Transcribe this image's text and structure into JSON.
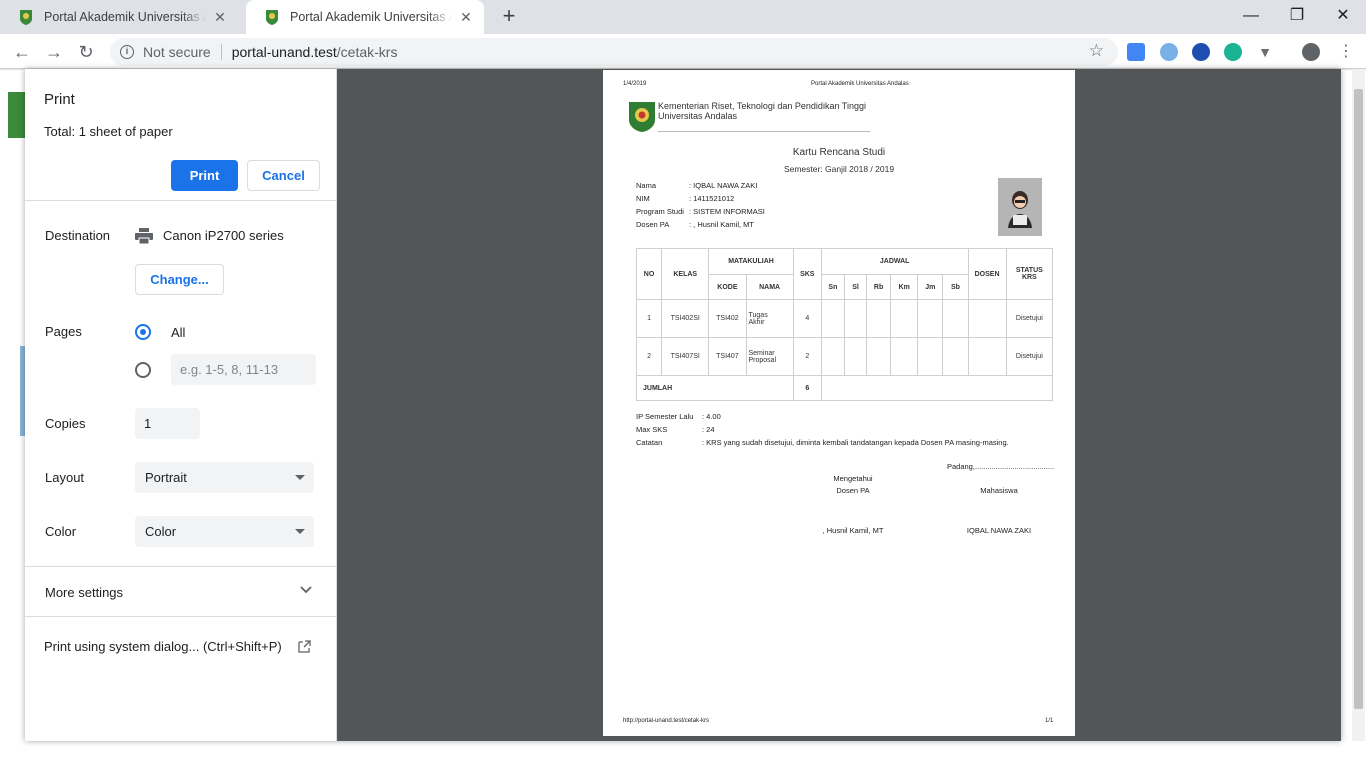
{
  "browser": {
    "tabs": [
      {
        "title": "Portal Akademik Universitas Andalas",
        "active": false
      },
      {
        "title": "Portal Akademik Universitas Andalas",
        "active": true
      }
    ],
    "new_tab": "+",
    "url_security": "Not secure",
    "url_host": "portal-unand.test",
    "url_path": "/cetak-krs"
  },
  "print_dialog": {
    "title": "Print",
    "total_label": "Total:",
    "total_value": "1 sheet of paper",
    "print_button": "Print",
    "cancel_button": "Cancel",
    "destination_label": "Destination",
    "destination_value": "Canon iP2700 series",
    "change_button": "Change...",
    "pages_label": "Pages",
    "pages_all": "All",
    "pages_custom_placeholder": "e.g. 1-5, 8, 11-13",
    "copies_label": "Copies",
    "copies_value": "1",
    "layout_label": "Layout",
    "layout_value": "Portrait",
    "color_label": "Color",
    "color_value": "Color",
    "more_settings": "More settings",
    "system_dialog": "Print using system dialog... (Ctrl+Shift+P)"
  },
  "paper": {
    "header_date": "1/4/2019",
    "header_title": "Portal Akademik Universitas Andalas",
    "org_line1": "Kementerian Riset, Teknologi dan Pendidikan Tinggi",
    "org_line2": "Universitas Andalas",
    "doc_title": "Kartu Rencana Studi",
    "semester": "Semester: Ganjil 2018 / 2019",
    "student": {
      "nama_label": "Nama",
      "nama_value": ": IQBAL NAWA ZAKI",
      "nim_label": "NIM",
      "nim_value": ": 1411521012",
      "prodi_label": "Program Studi",
      "prodi_value": ": SISTEM INFORMASI",
      "pa_label": "Dosen PA",
      "pa_value": ": , Husnil Kamil, MT"
    },
    "table": {
      "h_no": "NO",
      "h_kelas": "KELAS",
      "h_mk": "MATAKULIAH",
      "h_kode": "KODE",
      "h_nama": "NAMA",
      "h_sks": "SKS",
      "h_jadwal": "JADWAL",
      "h_dosen": "DOSEN",
      "h_status1": "STATUS",
      "h_status2": "KRS",
      "days": [
        "Sn",
        "Sl",
        "Rb",
        "Km",
        "Jm",
        "Sb"
      ],
      "rows": [
        {
          "no": "1",
          "kelas": "TSI402SI",
          "kode": "TSI402",
          "nama1": "Tugas",
          "nama2": "Akhir",
          "sks": "4",
          "status": "Disetujui"
        },
        {
          "no": "2",
          "kelas": "TSI407SI",
          "kode": "TSI407",
          "nama1": "Seminar",
          "nama2": "Proposal",
          "sks": "2",
          "status": "Disetujui"
        }
      ],
      "jumlah_label": "JUMLAH",
      "jumlah_value": "6"
    },
    "ip_label": "IP Semester Lalu",
    "ip_value": ": 4.00",
    "maxsks_label": "Max SKS",
    "maxsks_value": ": 24",
    "catatan_label": "Catatan",
    "catatan_value": ": KRS yang sudah disetujui, diminta kembali tandatangan kepada Dosen PA masing-masing.",
    "padang": "Padang,......................................",
    "mengetahui": "Mengetahui",
    "dosen_pa": "Dosen PA",
    "mahasiswa": "Mahasiswa",
    "sign_pa": ", Husnil Kamil, MT",
    "sign_mhs": "IQBAL NAWA ZAKI",
    "footer_url": "http://portal-unand.test/cetak-krs",
    "footer_page": "1/1"
  }
}
